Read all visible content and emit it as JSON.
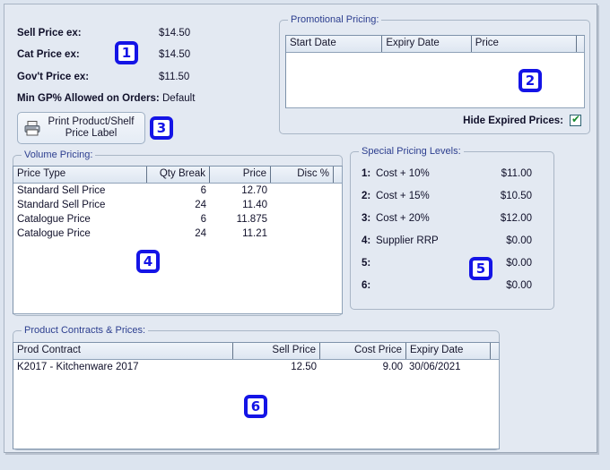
{
  "summary": {
    "rows": [
      {
        "label": "Sell Price ex:",
        "value": "$14.50"
      },
      {
        "label": "Cat Price ex:",
        "value": "$14.50"
      },
      {
        "label": "Gov't Price ex:",
        "value": "$11.50"
      }
    ],
    "min_gp_label": "Min GP% Allowed on Orders:",
    "min_gp_value": "Default"
  },
  "print_button": {
    "line1": "Print Product/Shelf",
    "line2": "Price Label",
    "icon": "printer-icon"
  },
  "promotional": {
    "title": "Promotional Pricing:",
    "columns": [
      "Start Date",
      "Expiry Date",
      "Price"
    ],
    "rows": [],
    "hide_expired_label": "Hide Expired Prices:",
    "hide_expired_checked": true,
    "check_glyph": "✔"
  },
  "volume": {
    "title": "Volume Pricing:",
    "columns": [
      "Price Type",
      "Qty Break",
      "Price",
      "Disc %"
    ],
    "rows": [
      {
        "price_type": "Standard Sell Price",
        "qty_break": "6",
        "price": "12.70",
        "disc": ""
      },
      {
        "price_type": "Standard Sell Price",
        "qty_break": "24",
        "price": "11.40",
        "disc": ""
      },
      {
        "price_type": "Catalogue Price",
        "qty_break": "6",
        "price": "11.875",
        "disc": ""
      },
      {
        "price_type": "Catalogue Price",
        "qty_break": "24",
        "price": "11.21",
        "disc": ""
      }
    ]
  },
  "special_levels": {
    "title": "Special Pricing Levels:",
    "rows": [
      {
        "num": "1:",
        "name": "Cost + 10%",
        "amount": "$11.00"
      },
      {
        "num": "2:",
        "name": "Cost + 15%",
        "amount": "$10.50"
      },
      {
        "num": "3:",
        "name": "Cost + 20%",
        "amount": "$12.00"
      },
      {
        "num": "4:",
        "name": "Supplier RRP",
        "amount": "$0.00"
      },
      {
        "num": "5:",
        "name": "",
        "amount": "$0.00"
      },
      {
        "num": "6:",
        "name": "",
        "amount": "$0.00"
      }
    ]
  },
  "contracts": {
    "title": "Product Contracts & Prices:",
    "columns": [
      "Prod Contract",
      "Sell Price",
      "Cost Price",
      "Expiry Date"
    ],
    "rows": [
      {
        "contract": "K2017  - Kitchenware 2017",
        "sell_price": "12.50",
        "cost_price": "9.00",
        "expiry": "30/06/2021"
      }
    ]
  },
  "markers": {
    "m1": "1",
    "m2": "2",
    "m3": "3",
    "m4": "4",
    "m5": "5",
    "m6": "6"
  },
  "colors": {
    "panel_background": "#e3e9f2",
    "marker_blue": "#1414e6",
    "group_title_blue": "#2c3e8f",
    "check_green": "#178a2e"
  }
}
